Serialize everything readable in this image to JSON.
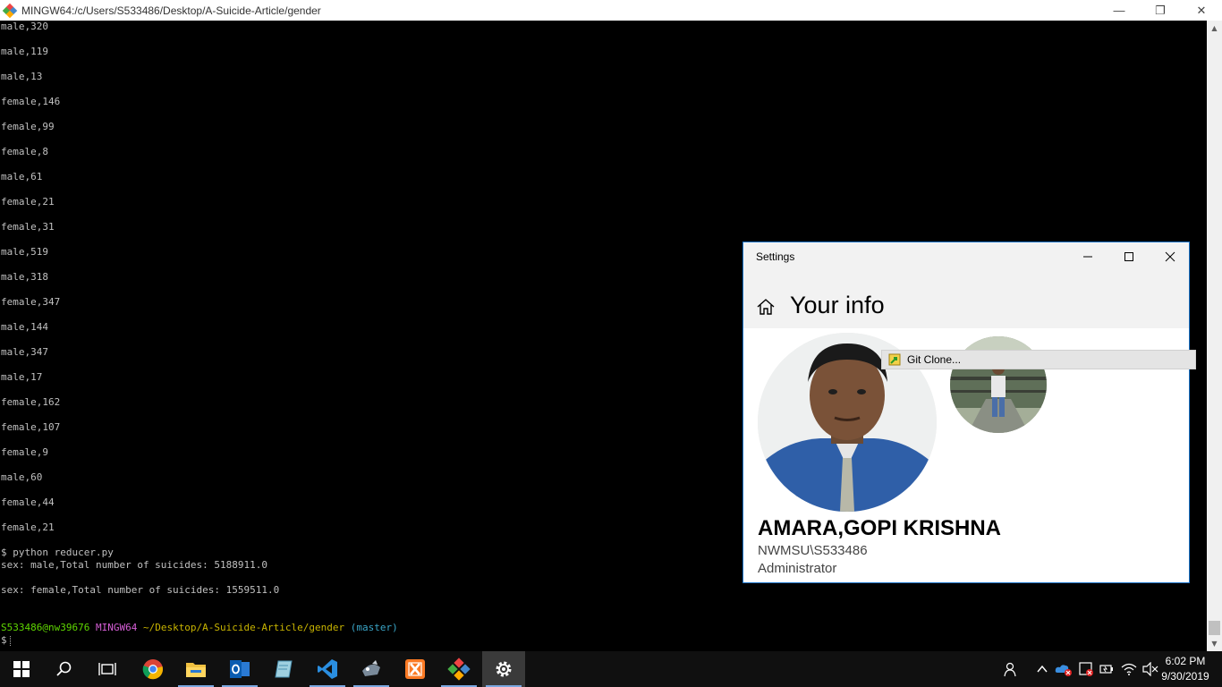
{
  "terminal": {
    "title": "MINGW64:/c/Users/S533486/Desktop/A-Suicide-Article/gender",
    "controls": {
      "minimize": "—",
      "restore": "❐",
      "close": "✕"
    },
    "lines": [
      "male,320",
      "male,119",
      "male,13",
      "female,146",
      "female,99",
      "female,8",
      "male,61",
      "female,21",
      "female,31",
      "male,519",
      "male,318",
      "female,347",
      "male,144",
      "male,347",
      "male,17",
      "female,162",
      "female,107",
      "female,9",
      "male,60",
      "female,44",
      "female,21"
    ],
    "command": "$ python reducer.py",
    "output": [
      "sex: male,Total number of suicides: 5188911.0",
      "sex: female,Total number of suicides: 1559511.0"
    ],
    "prompt": {
      "user": "S533486@nw39676",
      "shell": "MINGW64",
      "path": "~/Desktop/A-Suicide-Article/gender",
      "branch": "(master)",
      "symbol": "$"
    }
  },
  "settings": {
    "title": "Settings",
    "page_title": "Your info",
    "user_name": "AMARA,GOPI KRISHNA",
    "domain": "NWMSU\\S533486",
    "role": "Administrator"
  },
  "tooltip": {
    "label": "Git Clone..."
  },
  "taskbar": {
    "apps": [
      "start-icon",
      "search-icon",
      "task-view-icon",
      "chrome-icon",
      "file-explorer-icon",
      "outlook-icon",
      "notepad-icon",
      "vscode-icon",
      "ide-icon",
      "xampp-icon",
      "git-icon",
      "settings-icon"
    ],
    "time": "6:02 PM",
    "date": "9/30/2019"
  },
  "colors": {
    "accent": "#1a73c8",
    "prompt_green": "#5fd700",
    "prompt_magenta": "#d75fd7",
    "prompt_yellow": "#c8b400",
    "prompt_cyan": "#3aa6c8"
  }
}
